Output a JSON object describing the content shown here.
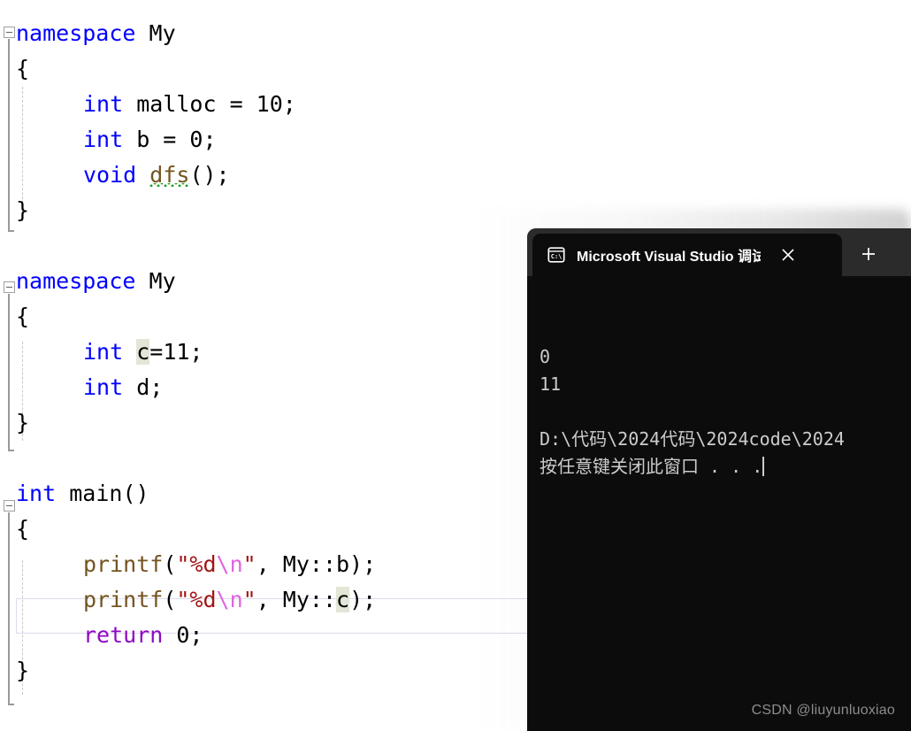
{
  "editor": {
    "name": "visual-studio-code-editor",
    "lines": [
      {
        "id": "l1",
        "indent": 0,
        "tokens": [
          {
            "t": "namespace",
            "c": "kw"
          },
          {
            "t": " My",
            "c": "plain"
          }
        ]
      },
      {
        "id": "l2",
        "indent": 0,
        "tokens": [
          {
            "t": "{",
            "c": "plain"
          }
        ]
      },
      {
        "id": "l3",
        "indent": 1,
        "tokens": [
          {
            "t": "int",
            "c": "kw"
          },
          {
            "t": " malloc = 10;",
            "c": "plain"
          }
        ]
      },
      {
        "id": "l4",
        "indent": 1,
        "tokens": [
          {
            "t": "int",
            "c": "kw"
          },
          {
            "t": " b = 0;",
            "c": "plain"
          }
        ]
      },
      {
        "id": "l5",
        "indent": 1,
        "tokens": [
          {
            "t": "void",
            "c": "kw"
          },
          {
            "t": " ",
            "c": "plain"
          },
          {
            "t": "dfs",
            "c": "squiggle"
          },
          {
            "t": "();",
            "c": "plain"
          }
        ]
      },
      {
        "id": "l6",
        "indent": 0,
        "tokens": [
          {
            "t": "}",
            "c": "plain"
          }
        ]
      },
      {
        "id": "l7",
        "indent": 0,
        "tokens": []
      },
      {
        "id": "l8",
        "indent": 0,
        "tokens": [
          {
            "t": "namespace",
            "c": "kw"
          },
          {
            "t": " My",
            "c": "plain"
          }
        ]
      },
      {
        "id": "l9",
        "indent": 0,
        "tokens": [
          {
            "t": "{",
            "c": "plain"
          }
        ]
      },
      {
        "id": "l10",
        "indent": 1,
        "tokens": [
          {
            "t": "int",
            "c": "kw"
          },
          {
            "t": " ",
            "c": "plain"
          },
          {
            "t": "c",
            "c": "hl"
          },
          {
            "t": "=11;",
            "c": "plain"
          }
        ]
      },
      {
        "id": "l11",
        "indent": 1,
        "tokens": [
          {
            "t": "int",
            "c": "kw"
          },
          {
            "t": " d;",
            "c": "plain"
          }
        ]
      },
      {
        "id": "l12",
        "indent": 0,
        "tokens": [
          {
            "t": "}",
            "c": "plain"
          }
        ]
      },
      {
        "id": "l13",
        "indent": 0,
        "tokens": []
      },
      {
        "id": "l14",
        "indent": 0,
        "tokens": [
          {
            "t": "int",
            "c": "kw"
          },
          {
            "t": " ",
            "c": "plain"
          },
          {
            "t": "main",
            "c": "plain"
          },
          {
            "t": "()",
            "c": "plain"
          }
        ]
      },
      {
        "id": "l15",
        "indent": 0,
        "tokens": [
          {
            "t": "{",
            "c": "plain"
          }
        ]
      },
      {
        "id": "l16",
        "indent": 1,
        "tokens": [
          {
            "t": "printf",
            "c": "fn"
          },
          {
            "t": "(",
            "c": "plain"
          },
          {
            "t": "\"%d",
            "c": "str"
          },
          {
            "t": "\\n",
            "c": "esc"
          },
          {
            "t": "\"",
            "c": "str"
          },
          {
            "t": ", My::b);",
            "c": "plain"
          }
        ]
      },
      {
        "id": "l17",
        "indent": 1,
        "tokens": [
          {
            "t": "printf",
            "c": "fn"
          },
          {
            "t": "(",
            "c": "plain"
          },
          {
            "t": "\"%d",
            "c": "str"
          },
          {
            "t": "\\n",
            "c": "esc"
          },
          {
            "t": "\"",
            "c": "str"
          },
          {
            "t": ", My::",
            "c": "plain"
          },
          {
            "t": "c",
            "c": "hl"
          },
          {
            "t": ");",
            "c": "plain"
          }
        ]
      },
      {
        "id": "l18",
        "indent": 1,
        "tokens": [
          {
            "t": "return",
            "c": "ctrl"
          },
          {
            "t": " 0;",
            "c": "plain"
          }
        ]
      },
      {
        "id": "l19",
        "indent": 0,
        "tokens": [
          {
            "t": "}",
            "c": "plain"
          }
        ]
      }
    ],
    "colors": {
      "keyword": "#0000ff",
      "control": "#8f08c4",
      "function": "#74531f",
      "string": "#a31515",
      "escape": "#e064e0",
      "plain": "#000000",
      "highlight_word_bg": "#e2e6d6",
      "current_line_border": "#dcdcec",
      "background": "#ffffff"
    }
  },
  "console": {
    "name": "debug-console-window",
    "tab": {
      "icon": "command-prompt-icon",
      "icon_label": "C:\\",
      "title": "Microsoft Visual Studio 调试控",
      "close_label": "×"
    },
    "new_tab_label": "+",
    "output_lines": [
      "0",
      "11",
      "",
      "D:\\代码\\2024代码\\2024code\\2024",
      "按任意键关闭此窗口 . . ."
    ],
    "colors": {
      "titlebar": "#2b2b2b",
      "tab_active": "#0c0c0c",
      "body": "#0c0c0c",
      "text": "#cccccc"
    }
  },
  "watermark": {
    "text": "CSDN @liuyunluoxiao"
  }
}
